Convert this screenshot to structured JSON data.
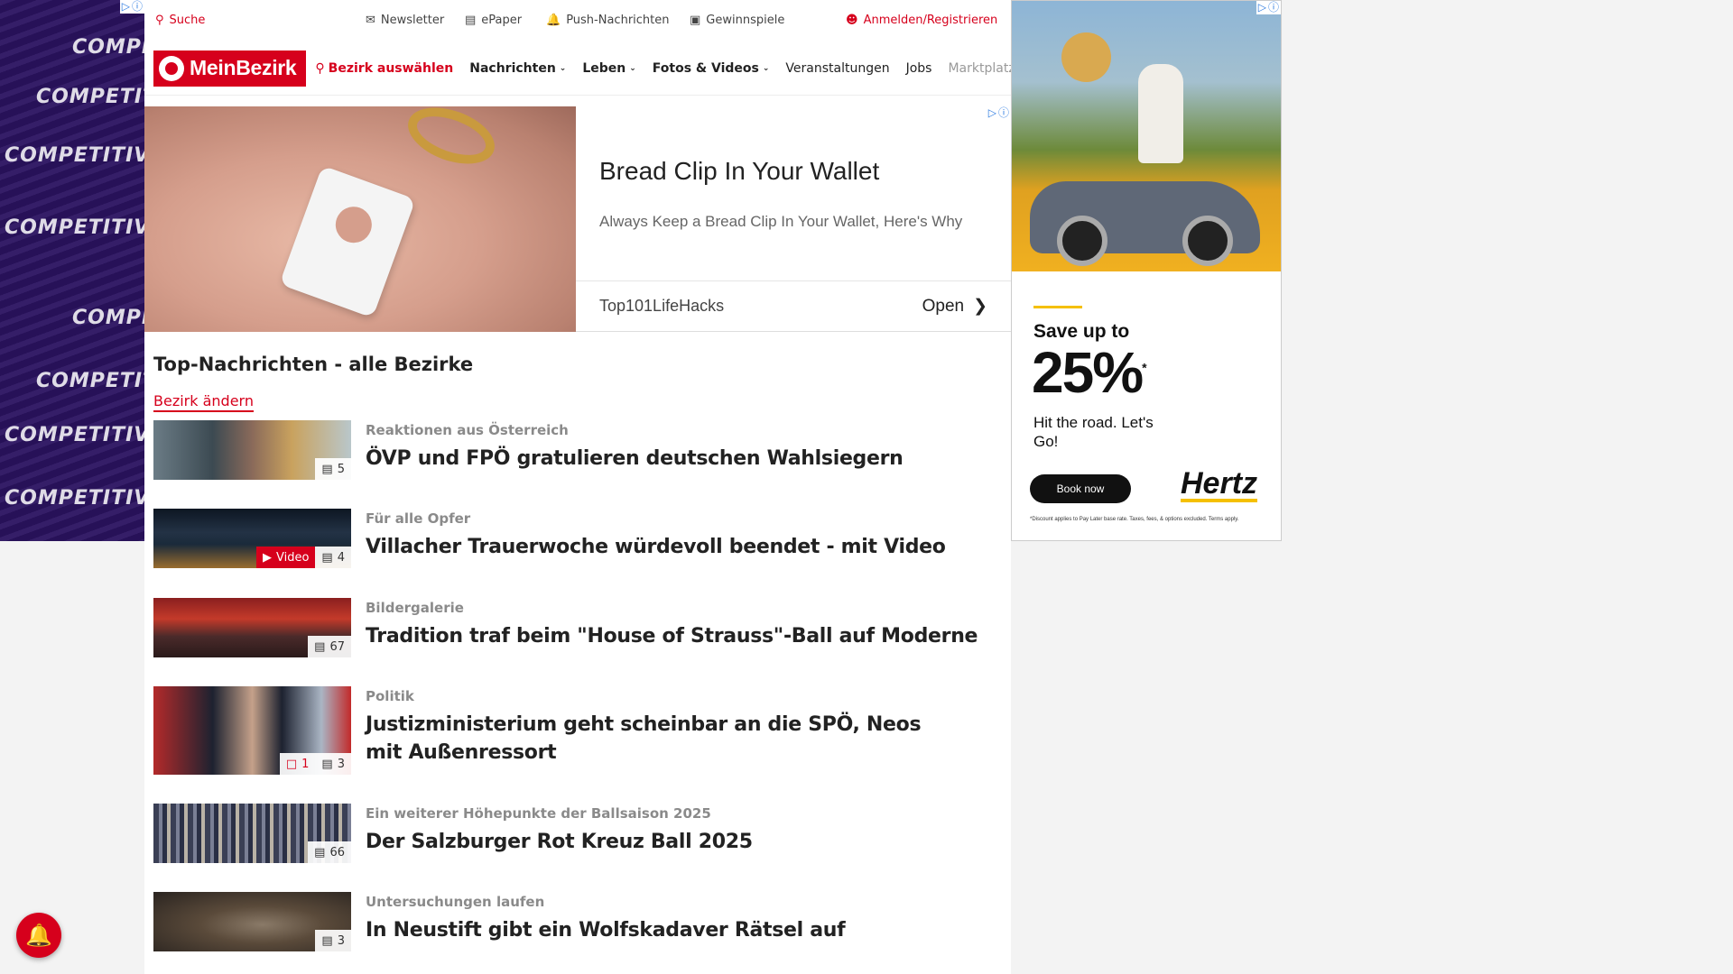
{
  "utility": {
    "search": "Suche",
    "newsletter": "Newsletter",
    "epaper": "ePaper",
    "push": "Push-Nachrichten",
    "gewinnspiele": "Gewinnspiele",
    "login": "Anmelden/Registrieren"
  },
  "nav": {
    "logo": "MeinBezirk",
    "bezirk": "Bezirk auswählen",
    "items": [
      "Nachrichten",
      "Leben",
      "Fotos & Videos",
      "Veranstaltungen",
      "Jobs",
      "Marktplatz"
    ]
  },
  "native_ad": {
    "title": "Bread Clip In Your Wallet",
    "description": "Always Keep a Bread Clip In Your Wallet, Here's Why",
    "source": "Top101LifeHacks",
    "cta": "Open"
  },
  "section": {
    "title": "Top-Nachrichten - alle Bezirke",
    "change": "Bezirk ändern"
  },
  "articles": [
    {
      "kicker": "Reaktionen aus Österreich",
      "headline": "ÖVP und FPÖ gratulieren deutschen Wahlsiegern",
      "images": "5"
    },
    {
      "kicker": "Für alle Opfer",
      "headline": "Villacher Trauerwoche würdevoll beendet - mit Video",
      "video": "Video",
      "images": "4"
    },
    {
      "kicker": "Bildergalerie",
      "headline": "Tradition traf beim \"House of Strauss\"-Ball auf Moderne",
      "images": "67"
    },
    {
      "kicker": "Politik",
      "headline": "Justizministerium geht scheinbar an die SPÖ, Neos mit Außenressort",
      "comments": "1",
      "images": "3"
    },
    {
      "kicker": "Ein weiterer Höhepunkte der Ballsaison 2025",
      "headline": "Der Salzburger Rot Kreuz Ball 2025",
      "images": "66"
    },
    {
      "kicker": "Untersuchungen laufen",
      "headline": "In Neustift gibt ein Wolfskadaver Rätsel auf",
      "images": "3"
    }
  ],
  "left_ad": {
    "lines": [
      "COMPETITIVE PRICING",
      "COMPETITIVE PRICING",
      "COMPETITIVE PRICING"
    ]
  },
  "right_ad": {
    "save": "Save up to",
    "percent": "25%",
    "asterisk": "*",
    "sub": "Hit the road. Let's Go!",
    "book": "Book now",
    "brand": "Hertz",
    "disclaimer": "*Discount applies to Pay Later base rate. Taxes, fees, & options excluded. Terms apply."
  },
  "colors": {
    "brand": "#d6001c",
    "ad_accent": "#f5c000"
  }
}
